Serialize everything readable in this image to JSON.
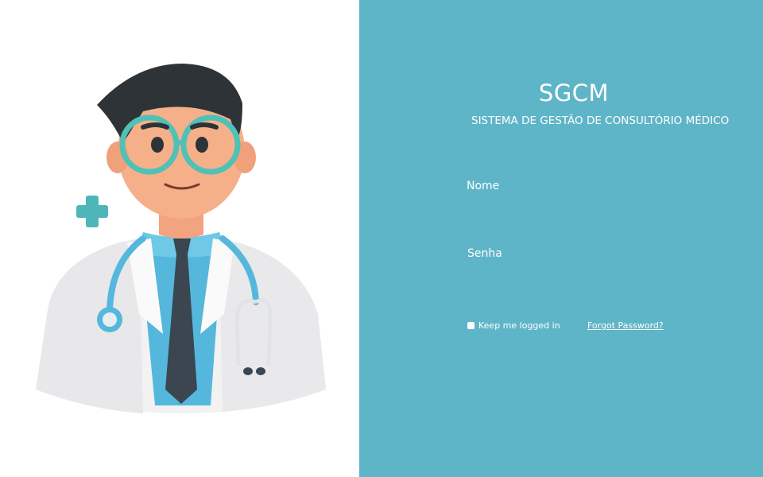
{
  "colors": {
    "panel_bg": "#5eb5c7",
    "text": "#ffffff"
  },
  "illustration": {
    "icon": "doctor-illustration"
  },
  "app": {
    "title": "SGCM",
    "subtitle": "SISTEMA DE GESTÃO DE CONSULTÓRIO MÉDICO"
  },
  "form": {
    "name_placeholder": "Nome",
    "password_placeholder": "Senha",
    "remember_label": "Keep me logged in",
    "forgot_label": "Forgot Password?"
  }
}
